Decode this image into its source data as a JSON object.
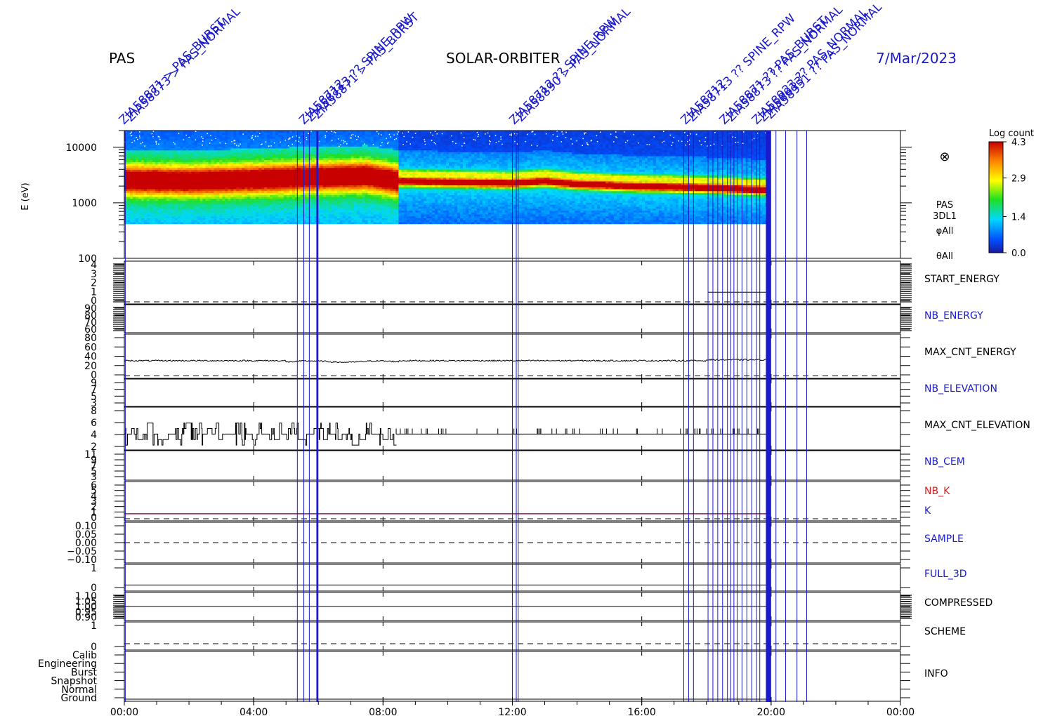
{
  "header": {
    "instrument": "PAS",
    "mission": "SOLAR-ORBITER",
    "date": "7/Mar/2023"
  },
  "colors": {
    "frame": "#000000",
    "marker": "#1a1acc",
    "label_blue": "#1a1acc",
    "label_red": "#d42020",
    "k_line": "#8a1f5c"
  },
  "chart_data": {
    "type": "heatmap",
    "x_axis": {
      "ticks": [
        "00:00",
        "04:00",
        "08:00",
        "12:00",
        "16:00",
        "20:00",
        "00:00"
      ],
      "range_hours": [
        0,
        24
      ]
    },
    "data_extent_hours": [
      0,
      19.9
    ],
    "spectrogram": {
      "ylabel": "E (eV)",
      "y_scale": "log",
      "ylim": [
        100,
        20000
      ],
      "y_ticks": [
        "10000",
        "1000",
        "100"
      ],
      "y_tick_values": [
        10000,
        1000,
        100
      ],
      "energy_floor_eV": 420,
      "labels": [
        "PAS",
        "3DL1",
        "φAll",
        "θAll"
      ],
      "peak_band_energy_eV": [
        [
          0,
          2600
        ],
        [
          2,
          2500
        ],
        [
          4,
          2700
        ],
        [
          5.5,
          2900
        ],
        [
          7.5,
          3100
        ],
        [
          8.5,
          2500
        ],
        [
          10,
          2400
        ],
        [
          12,
          2300
        ],
        [
          13,
          2500
        ],
        [
          14,
          2200
        ],
        [
          16,
          2000
        ],
        [
          18,
          1900
        ],
        [
          19.9,
          1700
        ]
      ],
      "colorbar": {
        "title": "Log count",
        "ticks": [
          "4.3",
          "2.9",
          "1.4",
          "0.0"
        ],
        "tick_values": [
          4.3,
          2.9,
          1.4,
          0.0
        ],
        "range": [
          0,
          4.3
        ]
      }
    },
    "markers_hours": [
      0.03,
      5.35,
      5.55,
      5.72,
      5.95,
      5.98,
      12.0,
      12.12,
      12.18,
      17.3,
      17.45,
      17.6,
      18.05,
      18.2,
      18.35,
      18.5,
      18.65,
      18.75,
      18.85,
      18.95,
      19.1,
      19.25,
      19.4,
      19.55,
      19.65,
      19.85,
      19.92,
      19.98,
      20.15,
      20.45,
      20.8,
      21.1
    ],
    "marker_annotations": [
      {
        "hour": 0.03,
        "texts": [
          "ZIA58871 > PAS_BURST",
          "ZIA58873 > PAS_NORMAL"
        ]
      },
      {
        "hour": 5.6,
        "texts": [
          "ZIA58712",
          "ZIA58713 ?? SPINE_RPW",
          "ZIA58871 > PAS_BURST"
        ]
      },
      {
        "hour": 12.1,
        "texts": [
          "ZIA58712 ?? SPINE_RPW",
          "ZIA58890 > PAS_NORMAL"
        ]
      },
      {
        "hour": 17.4,
        "texts": [
          "ZIA58712",
          "ZIA58713 ?? SPINE_RPW"
        ]
      },
      {
        "hour": 18.6,
        "texts": [
          "ZIA58871 ?? PAS_BURST",
          "ZIA58873 ?? PAS_NORMAL"
        ]
      },
      {
        "hour": 19.6,
        "texts": [
          "ZIA58923 ?? PAS_NORMAL",
          "ZIA58013",
          "ZIA58951 ?? PAS_NORMAL"
        ]
      }
    ],
    "panels": [
      {
        "name": "START_ENERGY",
        "label_color": "black",
        "y_ticks": [
          "4",
          "3",
          "2",
          "1",
          "0"
        ],
        "ylim": [
          0,
          4
        ],
        "dashed_at": 0,
        "end_level": 1
      },
      {
        "name": "NB_ENERGY",
        "label_color": "blue",
        "y_ticks": [
          "90",
          "80",
          "70",
          "60"
        ],
        "ylim": [
          58,
          92
        ]
      },
      {
        "name": "MAX_CNT_ENERGY",
        "label_color": "black",
        "y_ticks": [
          "80",
          "60",
          "40",
          "20",
          "0"
        ],
        "ylim": [
          0,
          90
        ],
        "series_level": 35,
        "dashed_at": 1
      },
      {
        "name": "NB_ELEVATION",
        "label_color": "blue",
        "y_ticks": [
          "9",
          "7",
          "5",
          "3"
        ],
        "ylim": [
          2,
          10
        ]
      },
      {
        "name": "MAX_CNT_ELEVATION",
        "label_color": "black",
        "y_ticks": [
          "8",
          "6",
          "4",
          "2"
        ],
        "ylim": [
          1.5,
          8.5
        ],
        "series_level": 4
      },
      {
        "name": "NB_CEM",
        "label_color": "blue",
        "y_ticks": [
          "11",
          "9",
          "7",
          "5",
          "3"
        ],
        "ylim": [
          2,
          12
        ]
      },
      {
        "name": "NB_K / K",
        "names": [
          "NB_K",
          "K"
        ],
        "label_colors": [
          "red",
          "blue"
        ],
        "y_ticks": [
          "6",
          "5",
          "4",
          "3",
          "2",
          "1",
          "0"
        ],
        "ylim": [
          0,
          7
        ],
        "series_level": 1,
        "dashed_at": 0
      },
      {
        "name": "SAMPLE",
        "label_color": "blue",
        "y_ticks": [
          "0.10",
          "0.05",
          "0.00",
          "−0.05",
          "−0.10"
        ],
        "ylim": [
          -0.12,
          0.12
        ],
        "dashed_at": 0
      },
      {
        "name": "FULL_3D",
        "label_color": "blue",
        "y_ticks": [
          "1",
          "0"
        ],
        "ylim": [
          -0.3,
          1.4
        ],
        "level": 0
      },
      {
        "name": "COMPRESSED",
        "label_color": "black",
        "y_ticks": [
          "1.10",
          "1.05",
          "1.00",
          "0.95",
          "0.90"
        ],
        "ylim": [
          0.88,
          1.12
        ],
        "level": 1.0
      },
      {
        "name": "SCHEME",
        "label_color": "black",
        "y_ticks": [
          "1",
          "0"
        ],
        "ylim": [
          -0.3,
          1.4
        ],
        "dashed_at": 0
      },
      {
        "name": "INFO",
        "label_color": "black",
        "y_ticks": [
          "Calib",
          "Engineering",
          "Burst",
          "Snapshot",
          "Normal",
          "Ground"
        ],
        "ylim": [
          0,
          5.4
        ],
        "level": 0
      }
    ]
  }
}
